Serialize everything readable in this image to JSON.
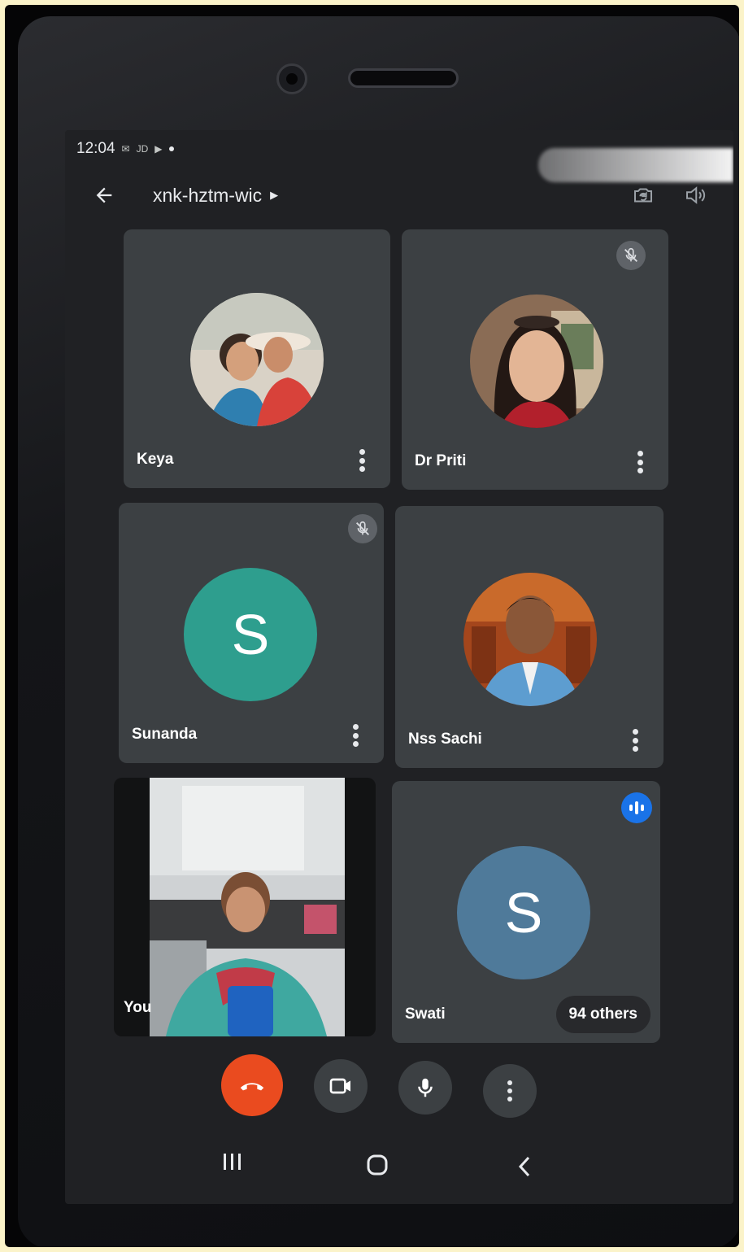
{
  "status_bar": {
    "time": "12:04",
    "notif_text": "JD"
  },
  "meeting": {
    "code": "xnk-hztm-wic"
  },
  "participants": [
    {
      "name": "Keya",
      "avatar": "photo",
      "muted": false
    },
    {
      "name": "Dr Priti",
      "avatar": "photo",
      "muted": true
    },
    {
      "name": "Sunanda",
      "avatar": "letter",
      "letter": "S",
      "avatar_color": "#2e9e8e",
      "muted": true
    },
    {
      "name": "Nss Sachi",
      "avatar": "photo",
      "muted": false
    },
    {
      "name": "You",
      "avatar": "video",
      "muted": false
    },
    {
      "name": "Swati",
      "avatar": "letter",
      "letter": "S",
      "avatar_color": "#4f7a9a",
      "speaking": true
    }
  ],
  "others_count_label": "94 others",
  "controls": {
    "end_call": "end-call-icon",
    "camera": "video-camera-icon",
    "mic": "microphone-icon",
    "more": "more-vertical-icon"
  },
  "nav": {
    "recents": "recents-icon",
    "home": "home-icon",
    "back": "back-nav-icon"
  },
  "colors": {
    "end_call": "#ea4b1f",
    "tile_bg": "#3c4043",
    "screen_bg": "#202124",
    "speaking_badge": "#1a73e8"
  }
}
